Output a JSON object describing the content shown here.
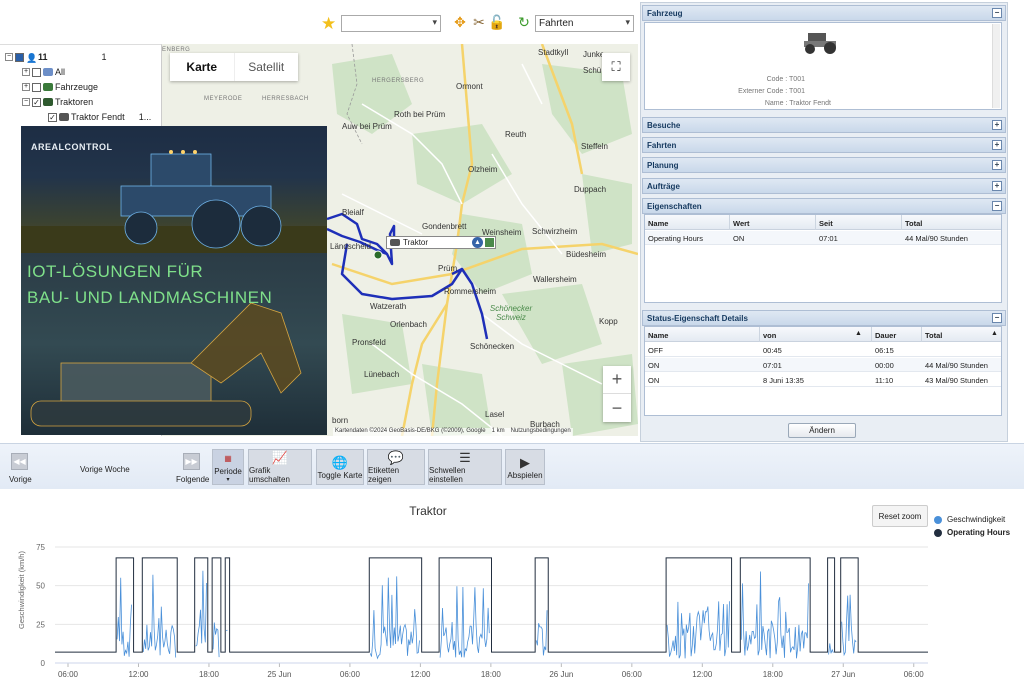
{
  "toolbar": {
    "fav_select_value": "",
    "type_select_value": "Fahrten"
  },
  "tree": {
    "root_label": "11",
    "root_count": "1",
    "items": [
      {
        "label": "All"
      },
      {
        "label": "Fahrzeuge"
      },
      {
        "label": "Traktoren"
      },
      {
        "label": "Traktor Fendt",
        "suffix": "1..."
      }
    ]
  },
  "ad": {
    "logo": "AREALCONTROL",
    "line1": "IOT-LÖSUNGEN FÜR",
    "line2": "BAU- UND LANDMASCHINEN"
  },
  "map": {
    "tab_map": "Karte",
    "tab_satellite": "Satellit",
    "zoom_in": "+",
    "zoom_out": "−",
    "popup_label": "Traktor",
    "attribution": "Kartendaten ©2024 GeoBasis-DE/BKG (©2009), Google",
    "scale": "1 km",
    "terms": "Nutzungsbedingungen",
    "places": [
      {
        "name": "Stadtkyll"
      },
      {
        "name": "Junke"
      },
      {
        "name": "Schü"
      },
      {
        "name": "HERGERSBERG"
      },
      {
        "name": "Ormont"
      },
      {
        "name": "MEYERODE"
      },
      {
        "name": "HERRESBACH"
      },
      {
        "name": "Roth bei Prüm"
      },
      {
        "name": "Auw bei Prüm"
      },
      {
        "name": "Reuth"
      },
      {
        "name": "Steffeln"
      },
      {
        "name": "Olzheim"
      },
      {
        "name": "Duppach"
      },
      {
        "name": "Gondenbrett"
      },
      {
        "name": "Weinsheim"
      },
      {
        "name": "Schwirzheim"
      },
      {
        "name": "Büdesheim"
      },
      {
        "name": "Prüm"
      },
      {
        "name": "Wallersheim"
      },
      {
        "name": "Rommersheim"
      },
      {
        "name": "Schönecker Schweiz"
      },
      {
        "name": "Watzerath"
      },
      {
        "name": "Orlenbach"
      },
      {
        "name": "Kopp"
      },
      {
        "name": "Pronsfeld"
      },
      {
        "name": "Schönecken"
      },
      {
        "name": "Lünebach"
      },
      {
        "name": "Lasel"
      },
      {
        "name": "Burbach"
      },
      {
        "name": "Bleialf"
      },
      {
        "name": "Ländscheid"
      },
      {
        "name": "ENBERG"
      },
      {
        "name": "born"
      }
    ]
  },
  "panel": {
    "fahrzeug_title": "Fahrzeug",
    "code_label": "Code :",
    "code_value": "T001",
    "ext_code_label": "Externer Code :",
    "ext_code_value": "T001",
    "name_label": "Name :",
    "name_value": "Traktor Fendt",
    "sections": [
      "Besuche",
      "Fahrten",
      "Planung",
      "Aufträge"
    ],
    "eigenschaften_title": "Eigenschaften",
    "eig_headers": [
      "Name",
      "Wert",
      "Seit",
      "Total"
    ],
    "eig_rows": [
      [
        "Operating Hours",
        "ON",
        "07:01",
        "44 Mal/90 Stunden"
      ]
    ],
    "status_title": "Status-Eigenschaft Details",
    "status_headers": [
      "Name",
      "von",
      "Dauer",
      "Total"
    ],
    "status_rows": [
      [
        "OFF",
        "00:45",
        "06:15",
        ""
      ],
      [
        "ON",
        "07:01",
        "00:00",
        "44 Mal/90 Stunden"
      ],
      [
        "ON",
        "8 Juni 13:35",
        "11:10",
        "43 Mal/90 Stunden"
      ]
    ],
    "andern_label": "Ändern"
  },
  "bottombar": {
    "prev_label": "Vorige",
    "period_label": "Vorige Woche",
    "next_label": "Folgende",
    "periode_label": "Periode",
    "grafik_label": "Grafik umschalten",
    "toggle_karte_label": "Toggle Karte",
    "etiketten_label": "Etiketten zeigen",
    "schwellen_label": "Schwellen einstellen",
    "abspielen_label": "Abspielen"
  },
  "chart_data": {
    "type": "line",
    "title": "Traktor",
    "ylabel": "Geschwindigkeit (km/h)",
    "ylim": [
      0,
      75
    ],
    "yticks": [
      0,
      25,
      50,
      75
    ],
    "xticks": [
      "06:00",
      "12:00",
      "18:00",
      "25 Jun",
      "06:00",
      "12:00",
      "18:00",
      "26 Jun",
      "06:00",
      "12:00",
      "18:00",
      "27 Jun",
      "06:00"
    ],
    "reset_zoom_label": "Reset zoom",
    "series": [
      {
        "name": "Geschwindigkeit",
        "color": "#4a90d9"
      },
      {
        "name": "Operating Hours",
        "color": "#222e3f"
      }
    ],
    "operating_hours_on_segments": [
      [
        0.07,
        0.09
      ],
      [
        0.1,
        0.14
      ],
      [
        0.16,
        0.175
      ],
      [
        0.18,
        0.19
      ],
      [
        0.195,
        0.2
      ],
      [
        0.36,
        0.42
      ],
      [
        0.44,
        0.5
      ],
      [
        0.55,
        0.565
      ],
      [
        0.7,
        0.775
      ],
      [
        0.785,
        0.865
      ],
      [
        0.885,
        0.893
      ],
      [
        0.9,
        0.92
      ]
    ]
  },
  "colors": {
    "accent": "#15395f",
    "speed": "#4a90d9",
    "hours": "#222e3f",
    "route": "#1e2fb8",
    "ad_text": "#7fe08a"
  }
}
